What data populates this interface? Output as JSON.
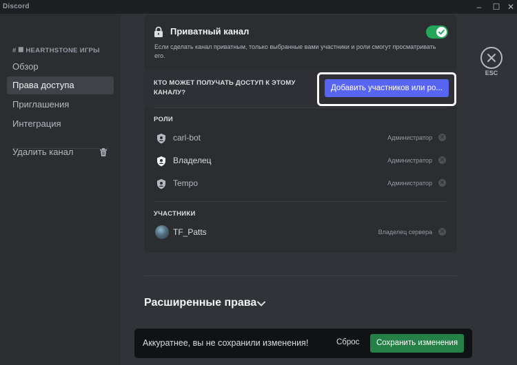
{
  "window": {
    "title": "Discord",
    "controls": [
      "–",
      "☐",
      "✕"
    ]
  },
  "sidebar": {
    "header": "# ⯀ HEARTHSTONE ИГРЫ",
    "items": [
      {
        "label": "Обзор"
      },
      {
        "label": "Права доступа"
      },
      {
        "label": "Приглашения"
      },
      {
        "label": "Интеграция"
      }
    ],
    "delete_label": "Удалить канал"
  },
  "private_channel": {
    "title": "Приватный канал",
    "description": "Если сделать канал приватным, только выбранные вами участники и роли смогут просматривать его.",
    "enabled": true
  },
  "access": {
    "question": "КТО МОЖЕТ ПОЛУЧАТЬ ДОСТУП К ЭТОМУ КАНАЛУ?",
    "add_button": "Добавить участников или ро..."
  },
  "roles": {
    "label": "РОЛИ",
    "items": [
      {
        "name": "carl-bot",
        "role": "Администратор"
      },
      {
        "name": "Владелец",
        "role": "Администратор"
      },
      {
        "name": "Tempo",
        "role": "Администратор"
      }
    ]
  },
  "members": {
    "label": "УЧАСТНИКИ",
    "items": [
      {
        "name": "TF_Patts",
        "role": "Владелец сервера"
      }
    ]
  },
  "advanced": {
    "title": "Расширенные права"
  },
  "esc_label": "ESC",
  "notice": {
    "text": "Аккуратнее, вы не сохранили изменения!",
    "reset": "Сброс",
    "save": "Сохранить изменения"
  },
  "colors": {
    "accent": "#5865f2",
    "toggle_on": "#23a55a",
    "save_green": "#248046",
    "background": "#313338",
    "sidebar": "#2b2d31"
  }
}
